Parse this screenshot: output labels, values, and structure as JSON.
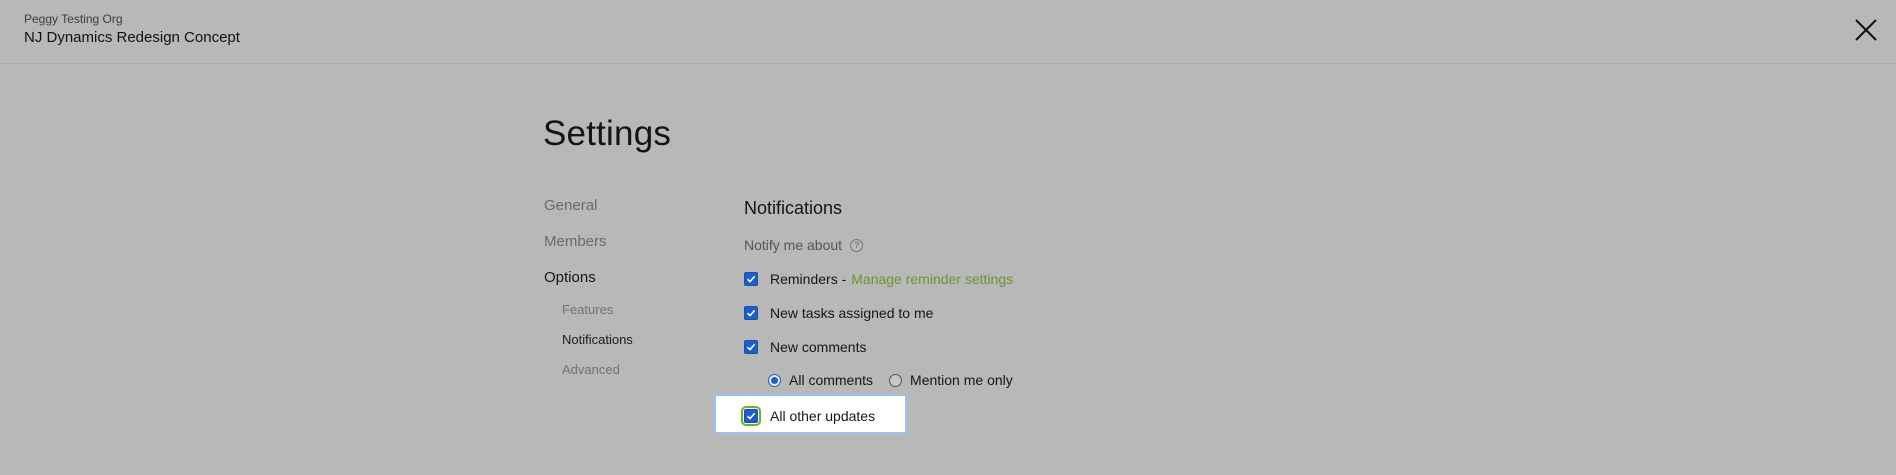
{
  "header": {
    "org_name": "Peggy Testing Org",
    "project_name": "NJ Dynamics Redesign Concept",
    "close_icon": "close-icon"
  },
  "page": {
    "title": "Settings"
  },
  "nav": {
    "items": [
      {
        "label": "General",
        "active": false
      },
      {
        "label": "Members",
        "active": false
      },
      {
        "label": "Options",
        "active": true
      }
    ],
    "sub_items": [
      {
        "label": "Features",
        "active": false
      },
      {
        "label": "Notifications",
        "active": true
      },
      {
        "label": "Advanced",
        "active": false
      }
    ]
  },
  "notifications": {
    "section_title": "Notifications",
    "notify_label": "Notify me about",
    "help_icon": "help-icon",
    "options": [
      {
        "label": "Reminders -",
        "link": "Manage reminder settings",
        "checked": true
      },
      {
        "label": "New tasks assigned to me",
        "checked": true
      },
      {
        "label": "New comments",
        "checked": true
      },
      {
        "label": "All other updates",
        "checked": true
      }
    ],
    "comment_modes": [
      {
        "label": "All comments",
        "selected": true
      },
      {
        "label": "Mention me only",
        "selected": false
      }
    ]
  },
  "colors": {
    "backdrop": "#b8b8b8",
    "checkbox": "#1f5dc8",
    "link": "#6b9432",
    "focus_outline": "#6bb025"
  }
}
